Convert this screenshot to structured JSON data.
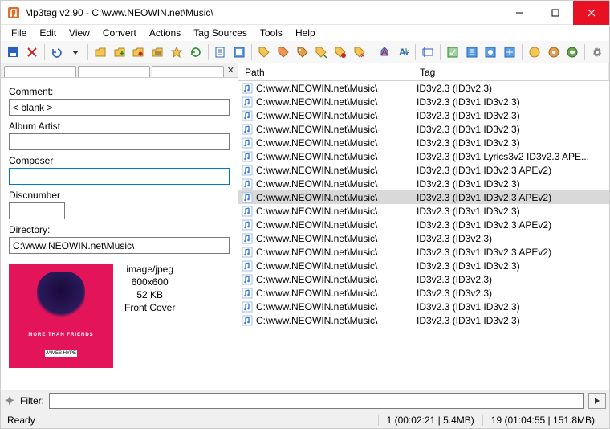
{
  "title": "Mp3tag v2.90  -  C:\\www.NEOWIN.net\\Music\\",
  "menu": [
    "File",
    "Edit",
    "View",
    "Convert",
    "Actions",
    "Tag Sources",
    "Tools",
    "Help"
  ],
  "left": {
    "comment_label": "Comment:",
    "comment_value": "< blank >",
    "albumartist_label": "Album Artist",
    "albumartist_value": "",
    "composer_label": "Composer",
    "composer_value": "",
    "discnumber_label": "Discnumber",
    "discnumber_value": "",
    "directory_label": "Directory:",
    "directory_value": "C:\\www.NEOWIN.net\\Music\\",
    "cover_meta": {
      "mime": "image/jpeg",
      "dims": "600x600",
      "size": "52 KB",
      "type": "Front Cover"
    },
    "cover_text1": "MORE THAN FRIENDS",
    "cover_text2": "JAMES HYPE"
  },
  "list": {
    "col_path": "Path",
    "col_tag": "Tag",
    "path_value": "C:\\www.NEOWIN.net\\Music\\",
    "rows": [
      {
        "tag": "ID3v2.3 (ID3v2.3)",
        "sel": false
      },
      {
        "tag": "ID3v2.3 (ID3v1 ID3v2.3)",
        "sel": false
      },
      {
        "tag": "ID3v2.3 (ID3v1 ID3v2.3)",
        "sel": false
      },
      {
        "tag": "ID3v2.3 (ID3v1 ID3v2.3)",
        "sel": false
      },
      {
        "tag": "ID3v2.3 (ID3v1 ID3v2.3)",
        "sel": false
      },
      {
        "tag": "ID3v2.3 (ID3v1 Lyrics3v2 ID3v2.3 APE...",
        "sel": false
      },
      {
        "tag": "ID3v2.3 (ID3v1 ID3v2.3 APEv2)",
        "sel": false
      },
      {
        "tag": "ID3v2.3 (ID3v1 ID3v2.3)",
        "sel": false
      },
      {
        "tag": "ID3v2.3 (ID3v1 ID3v2.3 APEv2)",
        "sel": true
      },
      {
        "tag": "ID3v2.3 (ID3v1 ID3v2.3)",
        "sel": false
      },
      {
        "tag": "ID3v2.3 (ID3v1 ID3v2.3 APEv2)",
        "sel": false
      },
      {
        "tag": "ID3v2.3 (ID3v2.3)",
        "sel": false
      },
      {
        "tag": "ID3v2.3 (ID3v1 ID3v2.3 APEv2)",
        "sel": false
      },
      {
        "tag": "ID3v2.3 (ID3v1 ID3v2.3)",
        "sel": false
      },
      {
        "tag": "ID3v2.3 (ID3v2.3)",
        "sel": false
      },
      {
        "tag": "ID3v2.3 (ID3v2.3)",
        "sel": false
      },
      {
        "tag": "ID3v2.3 (ID3v1 ID3v2.3)",
        "sel": false
      },
      {
        "tag": "ID3v2.3 (ID3v1 ID3v2.3)",
        "sel": false
      }
    ]
  },
  "filter": {
    "label": "Filter:",
    "value": ""
  },
  "status": {
    "ready": "Ready",
    "sel": "1 (00:02:21 | 5.4MB)",
    "total": "19 (01:04:55 | 151.8MB)"
  },
  "toolbar_icons": [
    "save",
    "delete",
    "|",
    "undo",
    "dropdown",
    "|",
    "folder-open",
    "folder-add",
    "folder-fav",
    "folder-list",
    "star",
    "refresh",
    "|",
    "playlist",
    "select-all",
    "|",
    "tag-file",
    "file-tag",
    "tag-tag",
    "copy-tag",
    "paste-tag",
    "cut-tag",
    "|",
    "actions",
    "actions-quick",
    "|",
    "rename",
    "|",
    "tools1",
    "tools2",
    "tools3",
    "tools4",
    "|",
    "sources1",
    "sources2",
    "sources3",
    "|",
    "settings"
  ]
}
